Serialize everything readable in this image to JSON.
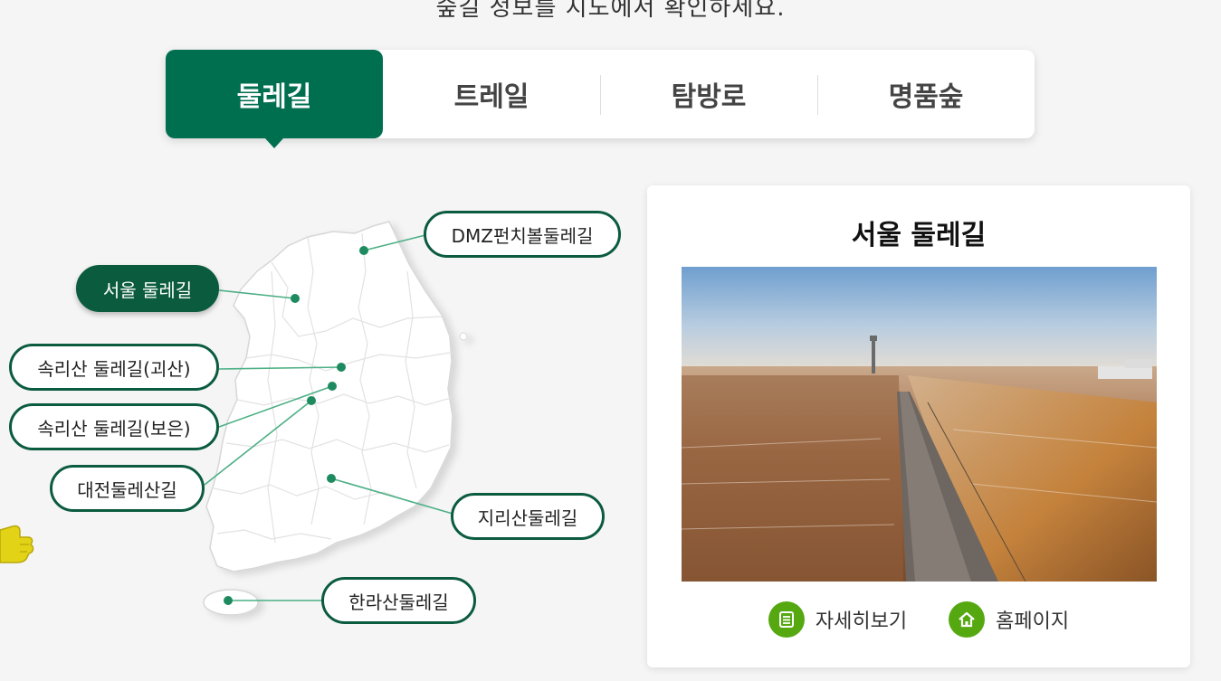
{
  "intro_text": "숲길 정보를 지도에서 확인하세요.",
  "tabs": [
    {
      "label": "둘레길",
      "active": true
    },
    {
      "label": "트레일",
      "active": false
    },
    {
      "label": "탐방로",
      "active": false
    },
    {
      "label": "명품숲",
      "active": false
    }
  ],
  "map": {
    "trails": [
      {
        "label": "DMZ펀치볼둘레길",
        "active": false
      },
      {
        "label": "서울 둘레길",
        "active": true
      },
      {
        "label": "속리산 둘레길(괴산)",
        "active": false
      },
      {
        "label": "속리산 둘레길(보은)",
        "active": false
      },
      {
        "label": "대전둘레산길",
        "active": false
      },
      {
        "label": "지리산둘레길",
        "active": false
      },
      {
        "label": "한라산둘레길",
        "active": false
      }
    ]
  },
  "detail": {
    "title": "서울 둘레길",
    "links": [
      {
        "label": "자세히보기",
        "icon": "document-icon"
      },
      {
        "label": "홈페이지",
        "icon": "home-icon"
      }
    ]
  },
  "colors": {
    "primary": "#006f50",
    "label_border": "#0b5b3f",
    "link_icon_bg": "#56a811",
    "marker": "#1e8a5f",
    "leader_line": "#4caf85"
  }
}
